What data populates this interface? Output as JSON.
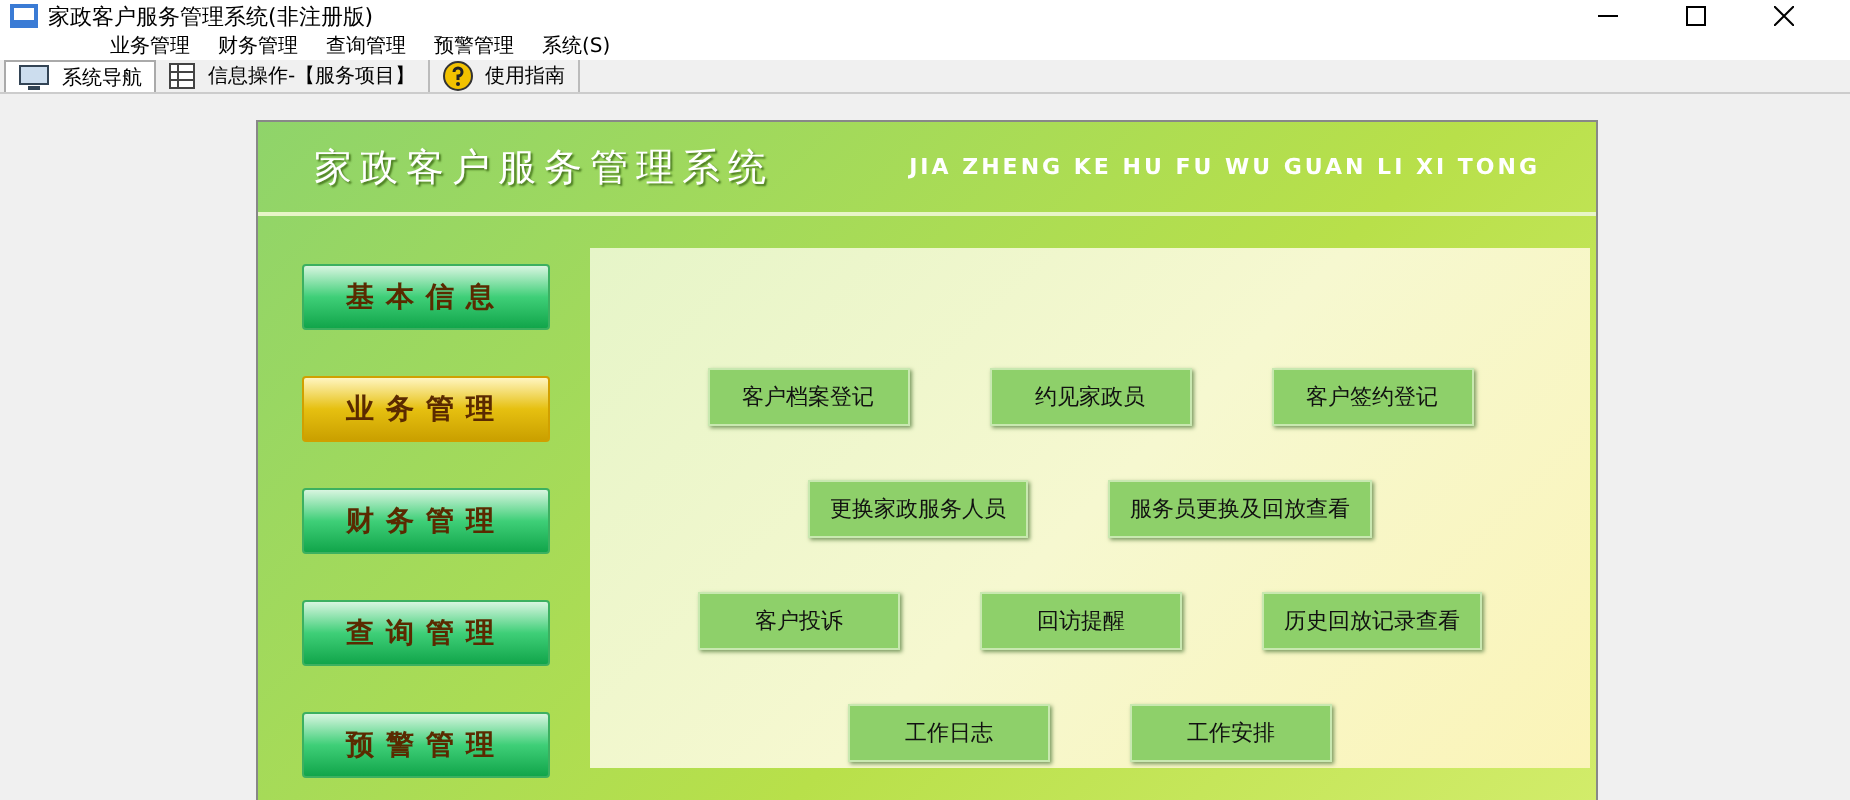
{
  "window": {
    "title": "家政客户服务管理系统(非注册版)"
  },
  "menu": [
    "业务管理",
    "财务管理",
    "查询管理",
    "预警管理",
    "系统(S)"
  ],
  "tabs": [
    {
      "label": "系统导航",
      "selected": true,
      "kind": "monitor"
    },
    {
      "label": "信息操作-【服务项目】",
      "selected": false,
      "kind": "grid"
    },
    {
      "label": "使用指南",
      "selected": false,
      "kind": "help"
    }
  ],
  "header": {
    "title": "家政客户服务管理系统",
    "pinyin": "JIA ZHENG KE HU FU WU GUAN LI XI TONG"
  },
  "sidebar": [
    {
      "label": "基本信息",
      "selected": false
    },
    {
      "label": "业务管理",
      "selected": true
    },
    {
      "label": "财务管理",
      "selected": false
    },
    {
      "label": "查询管理",
      "selected": false
    },
    {
      "label": "预警管理",
      "selected": false
    }
  ],
  "function_rows": [
    [
      "客户档案登记",
      "约见家政员",
      "客户签约登记"
    ],
    [
      "更换家政服务人员",
      "服务员更换及回放查看"
    ],
    [
      "客户投诉",
      "回访提醒",
      "历史回放记录查看"
    ],
    [
      "工作日志",
      "工作安排"
    ]
  ]
}
